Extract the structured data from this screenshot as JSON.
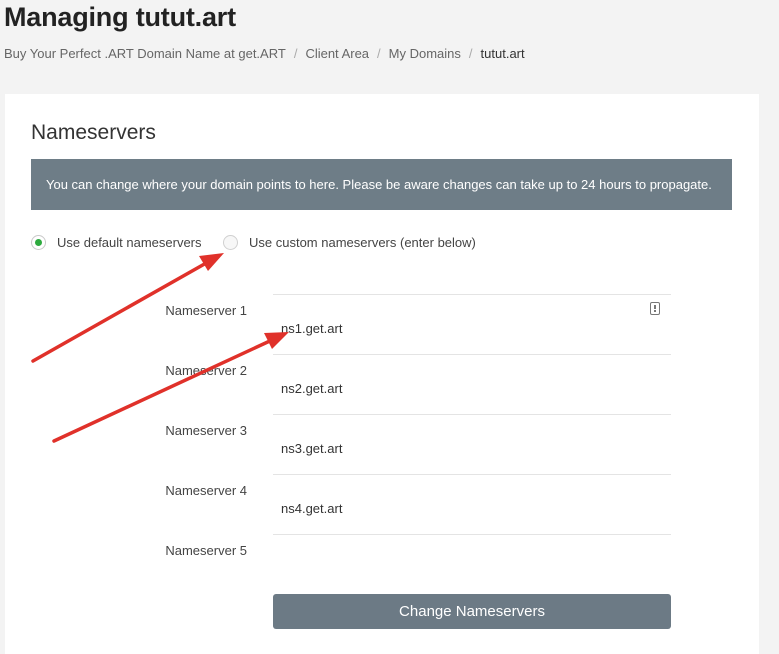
{
  "page": {
    "title": "Managing tutut.art"
  },
  "breadcrumb": {
    "items": [
      "Buy Your Perfect .ART Domain Name at get.ART",
      "Client Area",
      "My Domains",
      "tutut.art"
    ],
    "separator": "/"
  },
  "nameservers_card": {
    "title": "Nameservers",
    "info_text": "You can change where your domain points to here. Please be aware changes can take up to 24 hours to propagate.",
    "radio_default_label": "Use default nameservers",
    "radio_custom_label": "Use custom nameservers (enter below)",
    "selected_option": "default",
    "fields": [
      {
        "label": "Nameserver 1",
        "value": "ns1.get.art"
      },
      {
        "label": "Nameserver 2",
        "value": "ns2.get.art"
      },
      {
        "label": "Nameserver 3",
        "value": "ns3.get.art"
      },
      {
        "label": "Nameserver 4",
        "value": "ns4.get.art"
      },
      {
        "label": "Nameserver 5",
        "value": ""
      }
    ],
    "submit_label": "Change Nameservers",
    "password_manager_icon": "password-manager-icon"
  },
  "colors": {
    "banner_bg": "#6e7d87",
    "button_bg": "#6c7a85",
    "radio_checked": "#2eaa3f",
    "annotation_arrow": "#e0312a"
  },
  "annotations": {
    "arrow_count": 2,
    "icon": "red-arrow-annotation"
  }
}
